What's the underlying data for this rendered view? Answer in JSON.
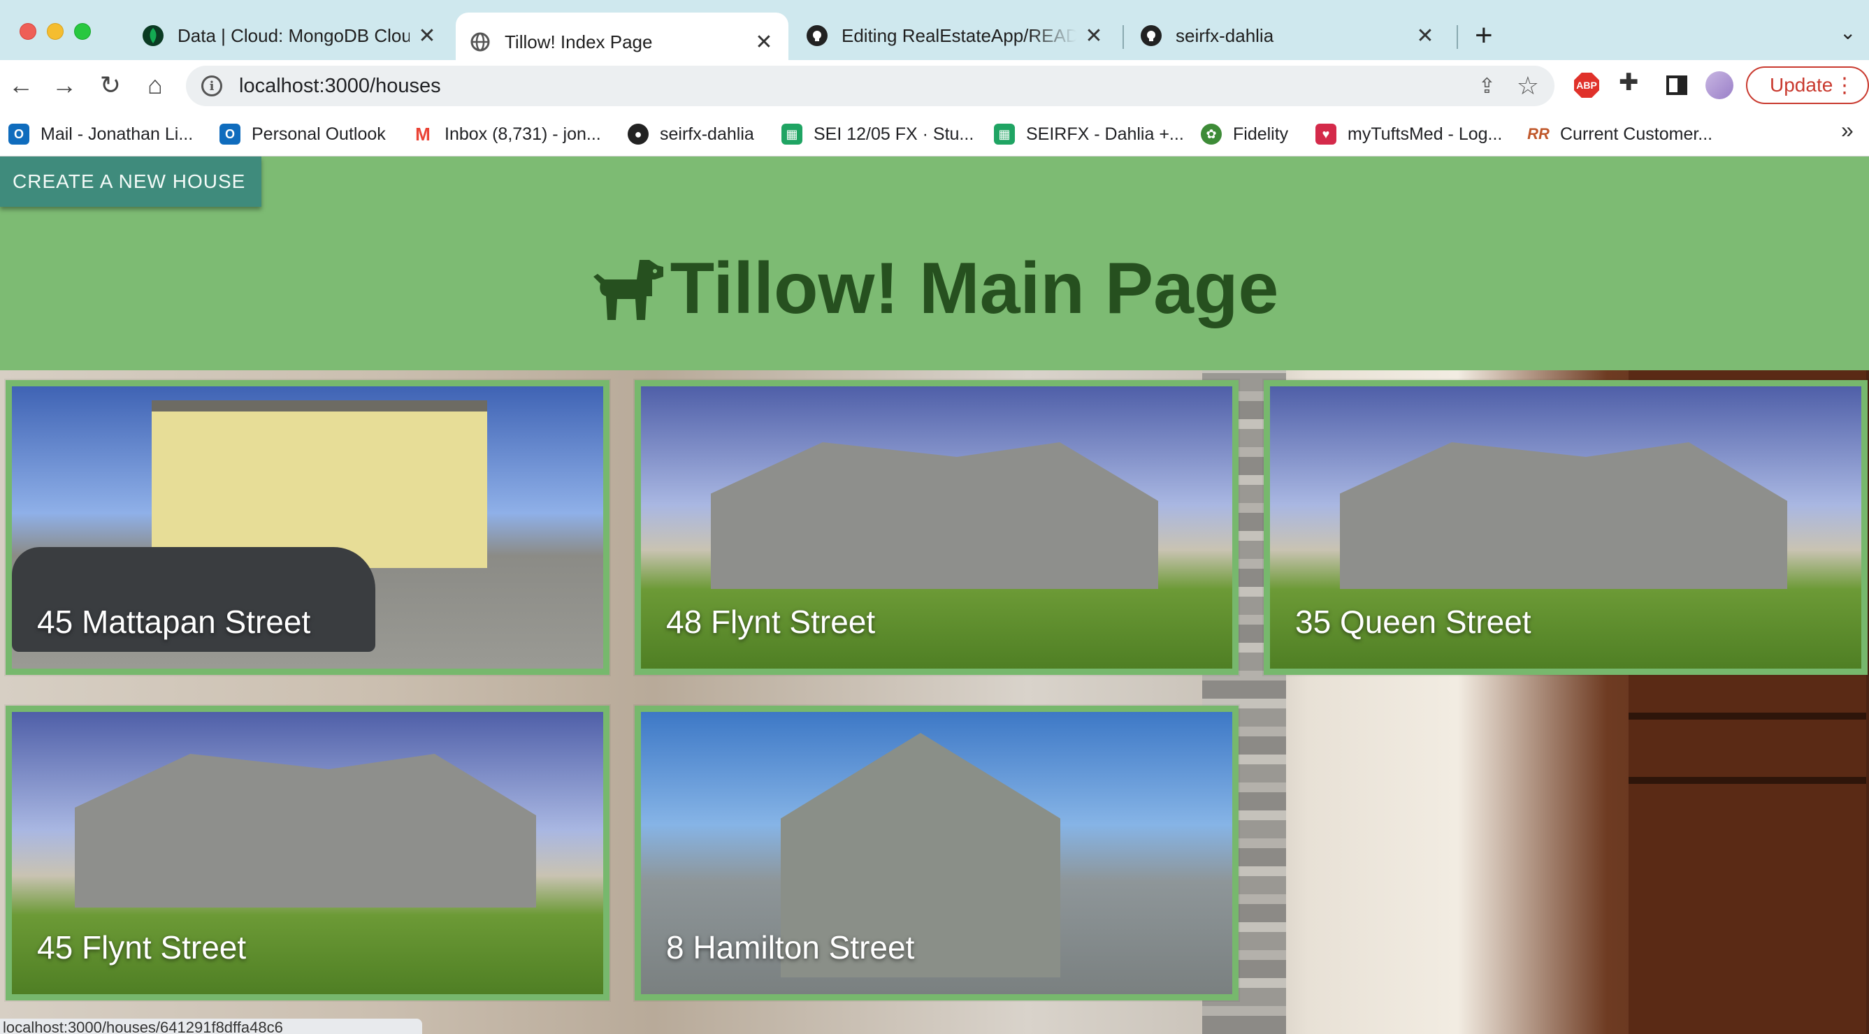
{
  "tabs": [
    {
      "title": "Data | Cloud: MongoDB Cloud",
      "icon": "mongodb-leaf-icon",
      "active": false
    },
    {
      "title": "Tillow! Index Page",
      "icon": "globe-icon",
      "active": true
    },
    {
      "title": "Editing RealEstateApp/README",
      "icon": "github-icon",
      "active": false
    },
    {
      "title": "seirfx-dahlia",
      "icon": "github-icon",
      "active": false
    }
  ],
  "toolbar": {
    "url": "localhost:3000/houses",
    "update_label": "Update",
    "abp_label": "ABP"
  },
  "bookmarks": [
    {
      "label": "Mail - Jonathan Li...",
      "icon": "outlook-icon",
      "color": "#0f6cbd"
    },
    {
      "label": "Personal Outlook",
      "icon": "outlook-icon",
      "color": "#0f6cbd"
    },
    {
      "label": "Inbox (8,731) - jon...",
      "icon": "gmail-icon",
      "color": "#ea4335"
    },
    {
      "label": "seirfx-dahlia",
      "icon": "github-icon",
      "color": "#222222"
    },
    {
      "label": "SEI 12/05 FX · Stu...",
      "icon": "sheets-icon",
      "color": "#1fa463"
    },
    {
      "label": "SEIRFX - Dahlia +...",
      "icon": "sheets-icon",
      "color": "#1fa463"
    },
    {
      "label": "Fidelity",
      "icon": "fidelity-icon",
      "color": "#3d8b37"
    },
    {
      "label": "myTuftsMed - Log...",
      "icon": "heart-icon",
      "color": "#d42a4a"
    },
    {
      "label": "Current Customer...",
      "icon": "rr-icon",
      "color": "#c0582b"
    }
  ],
  "page": {
    "create_button": "CREATE A NEW HOUSE",
    "title": "Tillow! Main Page",
    "header_color": "#7dbb73",
    "card_border_color": "#77b86d"
  },
  "houses": [
    {
      "name": "45 Mattapan Street"
    },
    {
      "name": "48 Flynt Street"
    },
    {
      "name": "35 Queen Street"
    },
    {
      "name": "45 Flynt Street"
    },
    {
      "name": "8 Hamilton Street"
    }
  ],
  "status_url": "localhost:3000/houses/641291f8dffa48c6"
}
